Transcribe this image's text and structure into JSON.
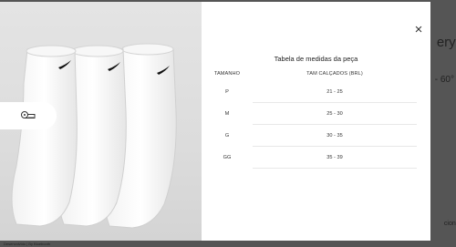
{
  "background": {
    "heading_fragment": "erye",
    "price_fragment": "- 60°",
    "button_fragment": "cionar",
    "footer_text": "Desenvolvido | By Bluebooth"
  },
  "modal": {
    "close_label": "×",
    "image_alt": "Three white ankle socks with black swoosh logo",
    "zoom_icon": "ruler-icon",
    "title": "Tabela de medidas da peça",
    "table": {
      "headers": [
        "TAMANHO",
        "TAM CALÇADOS (BRL)"
      ],
      "rows": [
        [
          "P",
          "21 - 25"
        ],
        [
          "M",
          "25 - 30"
        ],
        [
          "G",
          "30 - 35"
        ],
        [
          "GG",
          "35 - 39"
        ]
      ]
    }
  }
}
